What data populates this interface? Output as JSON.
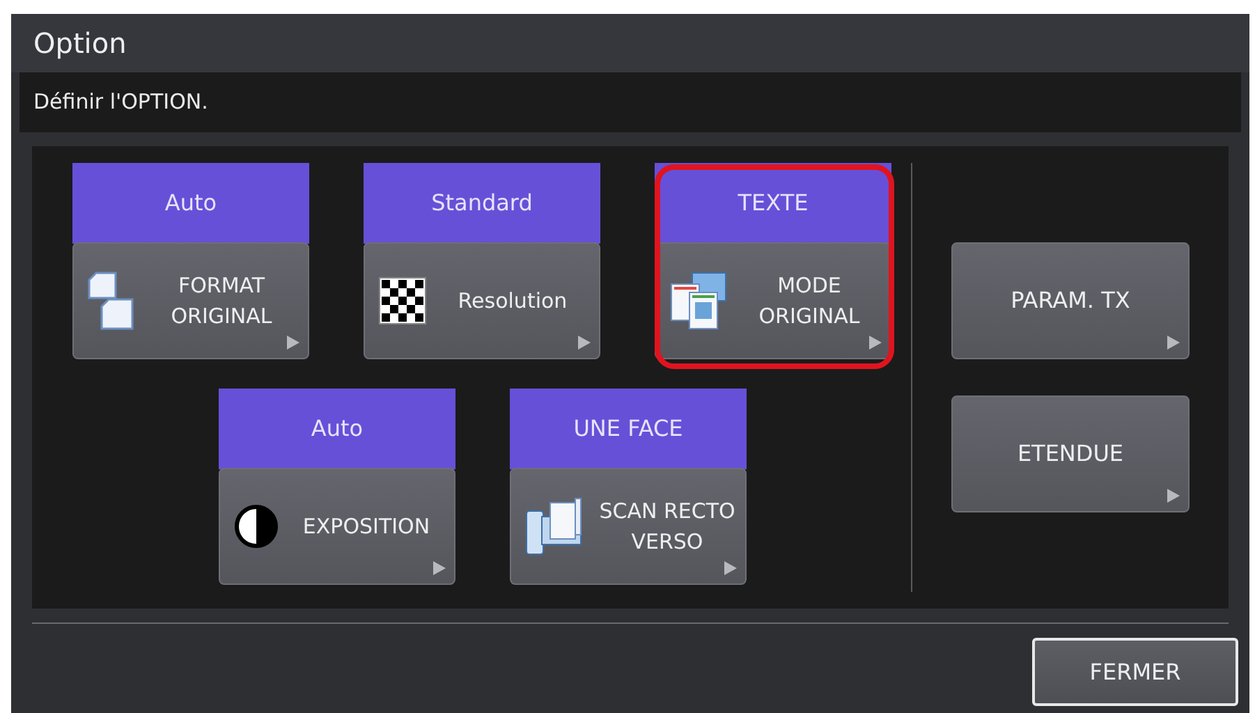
{
  "window": {
    "title": "Option"
  },
  "message": "Définir l'OPTION.",
  "tiles": [
    {
      "value": "Auto",
      "label": "FORMAT ORIGINAL",
      "kind": "pages",
      "highlighted": false
    },
    {
      "value": "Standard",
      "label": "Resolution",
      "kind": "checker",
      "highlighted": false
    },
    {
      "value": "TEXTE",
      "label": "MODE ORIGINAL",
      "kind": "documents",
      "highlighted": true
    },
    {
      "value": "Auto",
      "label": "EXPOSITION",
      "kind": "contrast",
      "highlighted": false
    },
    {
      "value": "UNE FACE",
      "label": "SCAN RECTO VERSO",
      "kind": "scanner",
      "highlighted": false
    }
  ],
  "side_buttons": [
    "PARAM. TX",
    "ETENDUE"
  ],
  "close_button": "FERMER"
}
